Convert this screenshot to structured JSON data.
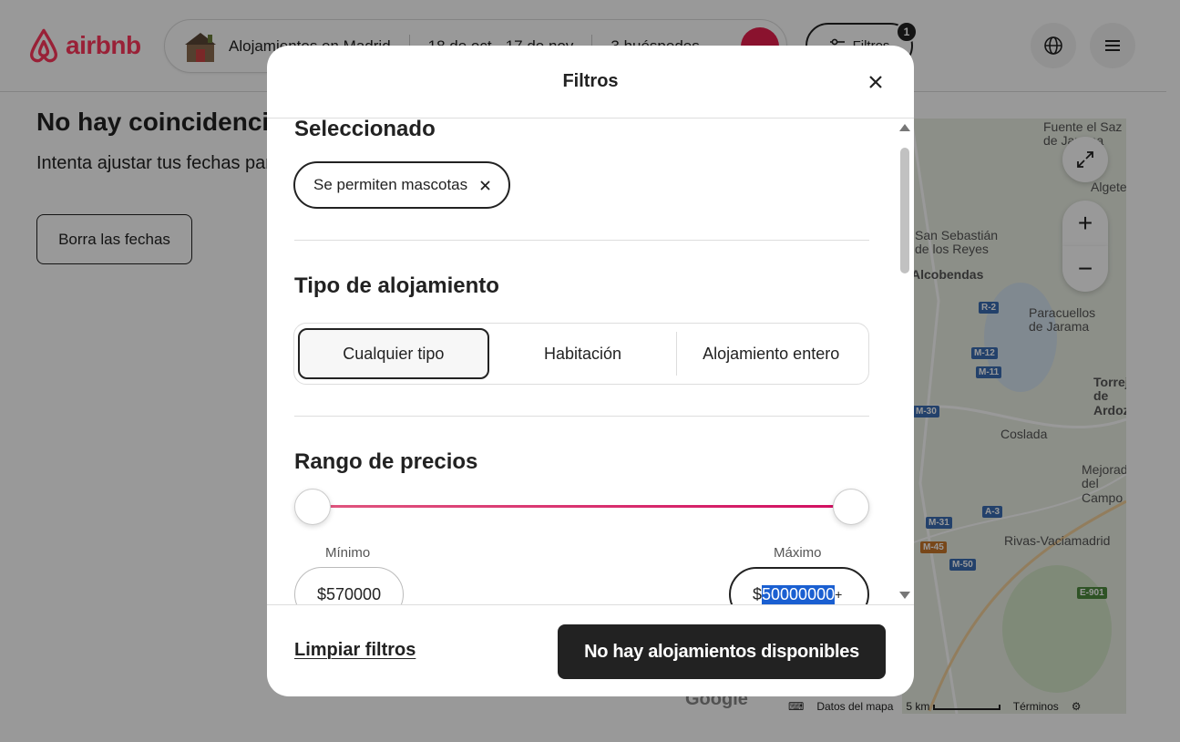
{
  "colors": {
    "brand": "#ff385c",
    "search_button": "#e61e4d",
    "slider_start": "#e0577f",
    "slider_end": "#d10e61",
    "selection": "#1a5fd1"
  },
  "header": {
    "logo_text": "airbnb",
    "search": {
      "location": "Alojamientos en Madrid",
      "dates": "18 de oct - 17 de nov",
      "guests": "3 huéspedes"
    },
    "filters_label": "Filtros",
    "filters_count": "1"
  },
  "results": {
    "title": "No hay coincidencias exactas",
    "subtitle": "Intenta ajustar tus fechas para ver más resultados.",
    "clear_dates_label": "Borra las fechas"
  },
  "map": {
    "labels": [
      "Fuente el Saz de Jarama",
      "Algete",
      "San Sebastián de los Reyes",
      "Alcobendas",
      "Paracuellos de Jarama",
      "Torrejón de Ardoz",
      "Coslada",
      "Mejorada del Campo",
      "Rivas-Vaciamadrid"
    ],
    "roads": [
      "R-2",
      "M-12",
      "M-11",
      "M-30",
      "A-3",
      "M-31",
      "M-45",
      "M-50",
      "E-901"
    ],
    "footer": {
      "data_label": "Datos del mapa",
      "scale": "5 km",
      "terms": "Términos"
    },
    "google": "Google"
  },
  "modal": {
    "title": "Filtros",
    "selected": {
      "title": "Seleccionado",
      "chip": "Se permiten mascotas"
    },
    "type": {
      "title": "Tipo de alojamiento",
      "options": [
        "Cualquier tipo",
        "Habitación",
        "Alojamiento entero"
      ],
      "selected_index": 0
    },
    "price": {
      "title": "Rango de precios",
      "min_label": "Mínimo",
      "max_label": "Máximo",
      "min_value": "$570000",
      "max_prefix": "$",
      "max_value": "50000000",
      "max_suffix": "+",
      "slider_min_fraction": 0,
      "slider_max_fraction": 1
    },
    "footer": {
      "clear_label": "Limpiar filtros",
      "submit_label": "No hay alojamientos disponibles"
    }
  }
}
